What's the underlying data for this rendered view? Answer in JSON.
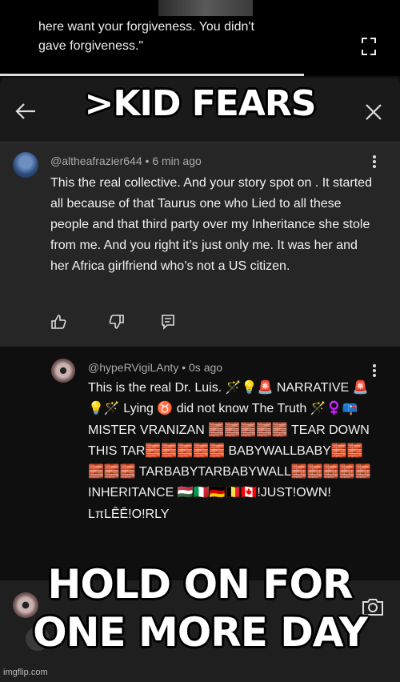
{
  "video": {
    "caption": "here want your forgiveness. You didn't\ngave forgiveness.\""
  },
  "meme": {
    "top_text": ">KID FEARS",
    "bottom_text": "HOLD ON FOR\nONE MORE DAY"
  },
  "comment": {
    "author": "@altheafrazier644",
    "time": "6 min ago",
    "text": "This the real collective. And your story spot on . It started all because of that Taurus one who Lied to all these people and that third party over my Inheritance she stole from me. And you right it’s just only me. It was her and her Africa girlfriend who’s not a US citizen."
  },
  "reply": {
    "author": "@hypeRVigiLAnty",
    "time": "0s ago",
    "text": "This is the real Dr. Luis. 🪄💡🚨 NARRATIVE 🚨💡🪄 Lying ♉ did not know The Truth 🪄♀️📪 MISTER VRANIZAN 🧱🧱🧱🧱🧱 TEAR DOWN THIS TAR🧱🧱🧱🧱🧱 BABYWALLBABY🧱🧱🧱🧱🧱 TARBABYTARBABYWALL🧱🧱🧱🧱🧱 INHERITANCE 🇭🇺🇮🇹🇩🇪🇧🇪🇨🇦!JUST!OWN! LπLÊĒ!O!RLY"
  },
  "watermark": "imgflip.com",
  "colors": {
    "background": "#0f0f0f",
    "comment_bg": "#262626",
    "meta": "#aaaaaa"
  }
}
